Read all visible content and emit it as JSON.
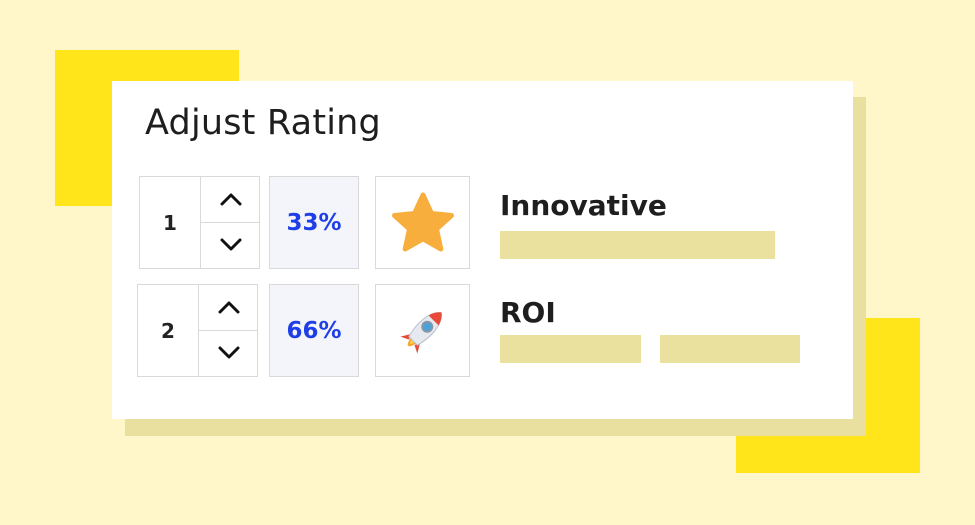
{
  "title": "Adjust Rating",
  "colors": {
    "background": "#fff7c9",
    "accent_yellow": "#ffe51a",
    "shadow": "#e9df9e",
    "placeholder": "#ebe19e",
    "percent_text": "#1f3fe6",
    "percent_bg": "#f4f4fb"
  },
  "items": [
    {
      "rank": "1",
      "percent": "33%",
      "icon": "star-icon",
      "label": "Innovative"
    },
    {
      "rank": "2",
      "percent": "66%",
      "icon": "rocket-icon",
      "label": "ROI"
    }
  ]
}
